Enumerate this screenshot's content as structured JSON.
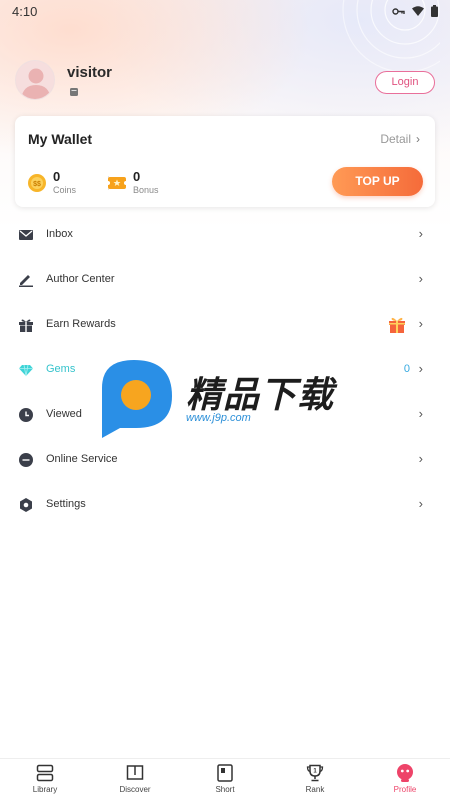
{
  "status_bar": {
    "time": "4:10"
  },
  "profile": {
    "username": "visitor",
    "login_label": "Login"
  },
  "wallet": {
    "title": "My Wallet",
    "detail_label": "Detail",
    "coins": {
      "value": "0",
      "label": "Coins"
    },
    "bonus": {
      "value": "0",
      "label": "Bonus"
    },
    "topup_label": "TOP UP"
  },
  "menu": [
    {
      "label": "Inbox",
      "icon": "mail-icon"
    },
    {
      "label": "Author Center",
      "icon": "pen-icon"
    },
    {
      "label": "Earn Rewards",
      "icon": "gift-icon"
    },
    {
      "label": "Gems",
      "icon": "gem-icon",
      "value": "0"
    },
    {
      "label": "Viewed",
      "icon": "clock-icon"
    },
    {
      "label": "Online Service",
      "icon": "chat-icon"
    },
    {
      "label": "Settings",
      "icon": "gear-icon"
    }
  ],
  "watermark": {
    "text": "精品下载",
    "url": "www.j9p.com"
  },
  "tabs": [
    {
      "label": "Library",
      "icon": "library-icon"
    },
    {
      "label": "Discover",
      "icon": "book-icon"
    },
    {
      "label": "Short",
      "icon": "short-video-icon"
    },
    {
      "label": "Rank",
      "icon": "trophy-icon"
    },
    {
      "label": "Profile",
      "icon": "profile-icon",
      "active": true
    }
  ],
  "colors": {
    "accent_pink": "#ee4469",
    "topup_orange": "#f56b3a",
    "gems_teal": "#35c3cc"
  }
}
